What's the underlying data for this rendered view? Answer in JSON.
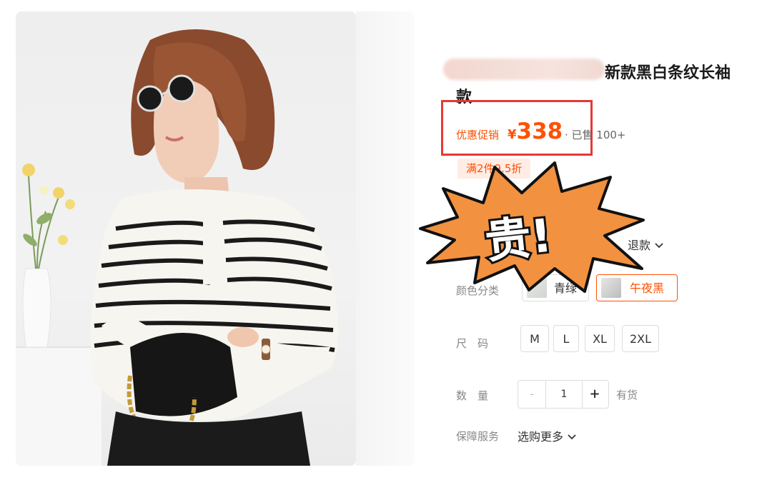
{
  "product": {
    "title_line1": "新款黑白条纹长袖",
    "title_line2": "款"
  },
  "price": {
    "promo_label": "优惠促销",
    "currency": "¥",
    "amount": "338",
    "sold": "· 已售 100+"
  },
  "coupon": "满2件9.5折",
  "sticker": {
    "text": "贵!",
    "fill_color": "#f2913f"
  },
  "return_policy_tail": "退款",
  "color": {
    "label": "颜色分类",
    "options": [
      {
        "label": "青绿",
        "selected": false
      },
      {
        "label": "午夜黑",
        "selected": true
      }
    ]
  },
  "size": {
    "label": "尺　码",
    "options": [
      "M",
      "L",
      "XL",
      "2XL"
    ]
  },
  "quantity": {
    "label": "数　量",
    "minus": "-",
    "value": "1",
    "plus": "+",
    "stock": "有货"
  },
  "service": {
    "label": "保障服务",
    "value": "选购更多"
  },
  "colors": {
    "accent": "#ff5000",
    "highlight_box": "#e53935"
  }
}
